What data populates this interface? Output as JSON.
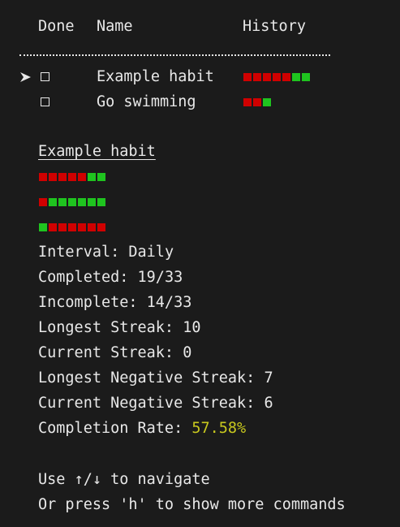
{
  "table": {
    "headers": {
      "done": "Done",
      "name": "Name",
      "history": "History"
    },
    "rows": [
      {
        "name": "Example habit",
        "done": false,
        "selected": true,
        "history": [
          "r",
          "r",
          "r",
          "r",
          "r",
          "g",
          "g"
        ]
      },
      {
        "name": "Go swimming",
        "done": false,
        "selected": false,
        "history": [
          "r",
          "r",
          "g"
        ]
      }
    ]
  },
  "detail": {
    "title": "Example habit",
    "history_rows": [
      [
        "r",
        "r",
        "r",
        "r",
        "r",
        "g",
        "g"
      ],
      [
        "r",
        "g",
        "g",
        "g",
        "g",
        "g",
        "g"
      ],
      [
        "g",
        "r",
        "r",
        "r",
        "r",
        "r",
        "r"
      ]
    ],
    "stats": {
      "interval_label": "Interval: ",
      "interval_value": "Daily",
      "completed_label": "Completed: ",
      "completed_value": "19/33",
      "incomplete_label": "Incomplete: ",
      "incomplete_value": "14/33",
      "longest_streak_label": "Longest Streak: ",
      "longest_streak_value": "10",
      "current_streak_label": "Current Streak: ",
      "current_streak_value": "0",
      "longest_negative_label": "Longest Negative Streak: ",
      "longest_negative_value": "7",
      "current_negative_label": "Current Negative Streak: ",
      "current_negative_value": "6",
      "completion_rate_label": "Completion Rate: ",
      "completion_rate_value": "57.58%"
    }
  },
  "help": {
    "navigate": "Use ↑/↓ to navigate",
    "more": "Or press 'h' to show more commands"
  },
  "colors": {
    "background": "#1b1b1b",
    "text": "#e8e8e8",
    "missed": "#d00000",
    "done": "#1fc41f",
    "rate": "#c8c81e"
  },
  "icons": {
    "selection": "arrow-pointer-icon",
    "checkbox": "checkbox-icon"
  }
}
